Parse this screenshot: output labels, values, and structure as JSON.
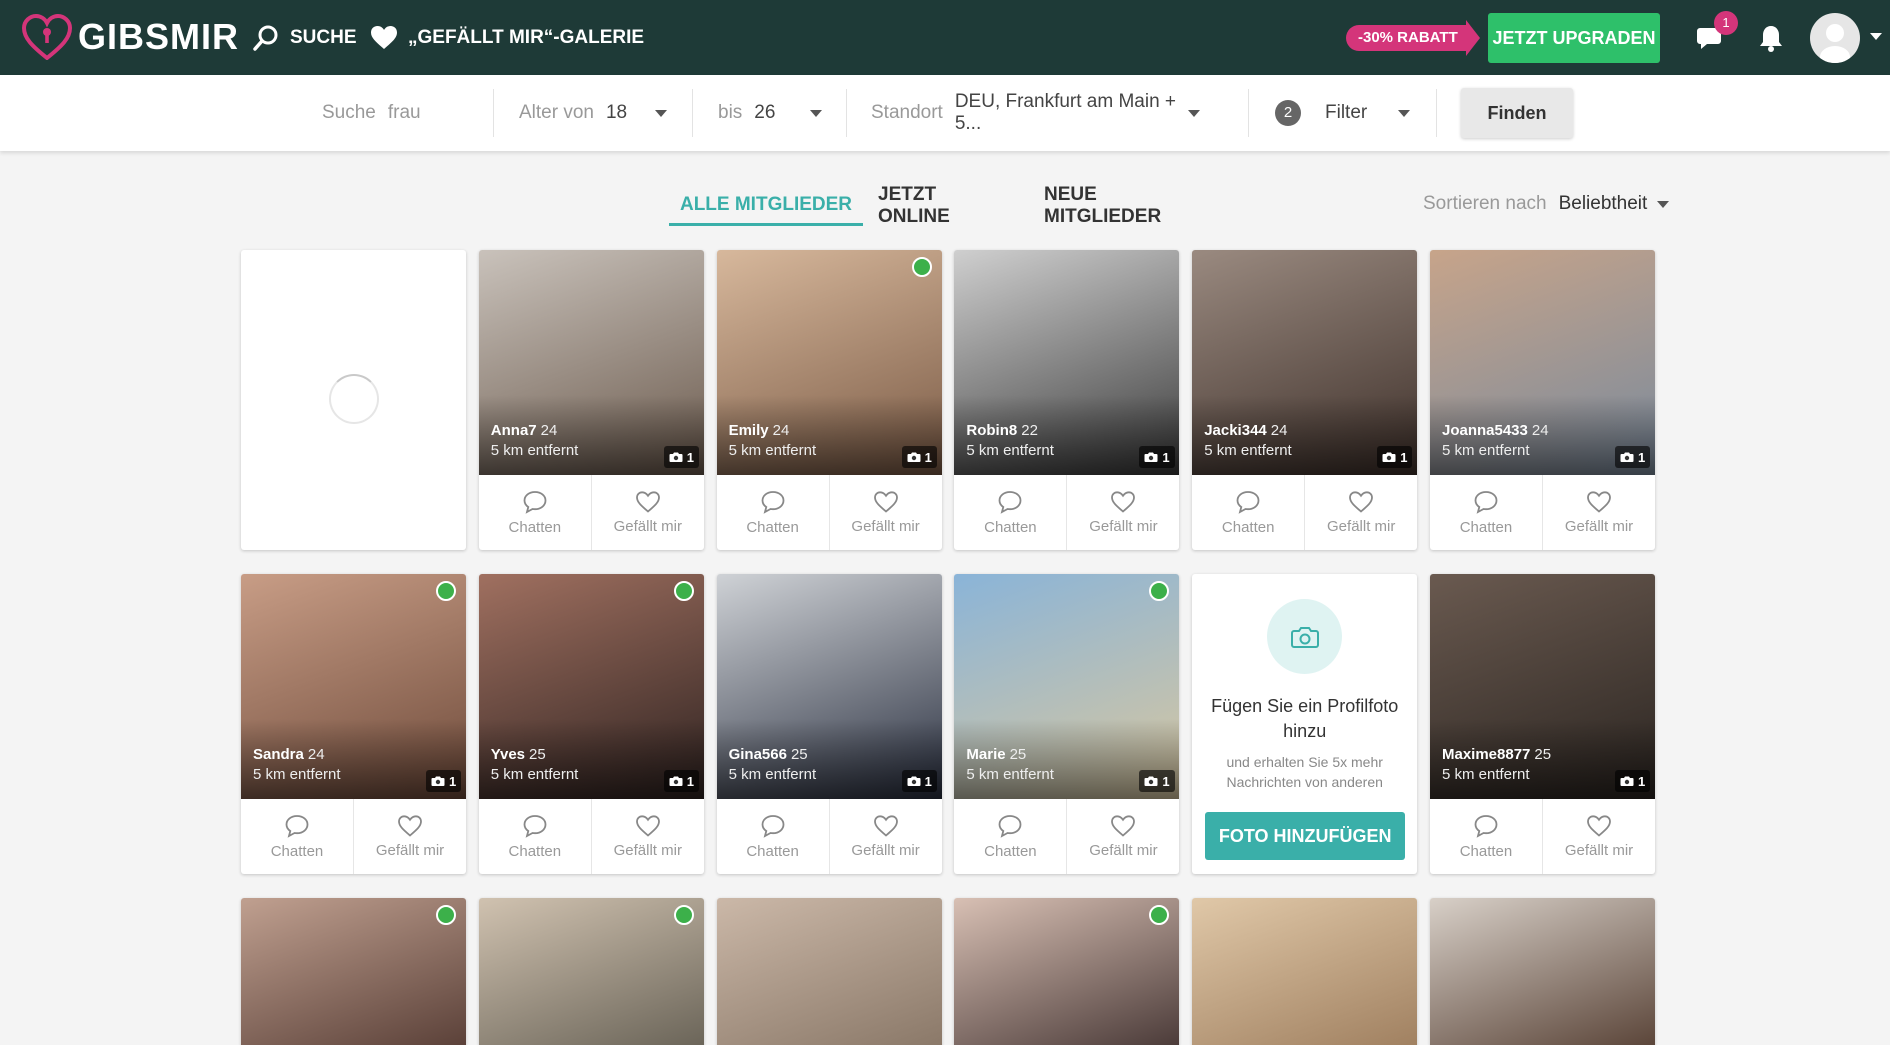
{
  "header": {
    "brand": "GIBSMIR",
    "nav_search": "Suche",
    "nav_gallery": "„Gefällt mir“-Galerie",
    "promo_badge": "-30% RABATT",
    "upgrade_label": "Jetzt upgraden",
    "messages_count": "1",
    "colors": {
      "bar": "#1e3a37",
      "accent": "#d4357a",
      "upgrade": "#2ec06a"
    }
  },
  "search": {
    "query_label": "Suche",
    "query_value": "frau",
    "age_from_label": "Alter von",
    "age_from_value": "18",
    "age_to_label": "bis",
    "age_to_value": "26",
    "location_label": "Standort",
    "location_value": "DEU, Frankfurt am Main + 5...",
    "filter_count": "2",
    "filter_label": "Filter",
    "find_label": "Finden"
  },
  "tabs": {
    "all": "Alle Mitglieder",
    "online": "Jetzt online",
    "new": "Neue Mitglieder",
    "active": "all",
    "accent_color": "#3aafa9"
  },
  "sort": {
    "label": "Sortieren nach",
    "value": "Beliebtheit"
  },
  "card_actions": {
    "chat": "Chatten",
    "like": "Gefällt mir"
  },
  "members_row1": [
    {
      "name": "Anna7",
      "age": "24",
      "distance": "5 km entfernt",
      "photos": "1",
      "online": false
    },
    {
      "name": "Emily",
      "age": "24",
      "distance": "5 km entfernt",
      "photos": "1",
      "online": true
    },
    {
      "name": "Robin8",
      "age": "22",
      "distance": "5 km entfernt",
      "photos": "1",
      "online": false
    },
    {
      "name": "Jacki344",
      "age": "24",
      "distance": "5 km entfernt",
      "photos": "1",
      "online": false
    },
    {
      "name": "Joanna5433",
      "age": "24",
      "distance": "5 km entfernt",
      "photos": "1",
      "online": false
    }
  ],
  "members_row2": [
    {
      "name": "Sandra",
      "age": "24",
      "distance": "5 km entfernt",
      "photos": "1",
      "online": true
    },
    {
      "name": "Yves",
      "age": "25",
      "distance": "5 km entfernt",
      "photos": "1",
      "online": true
    },
    {
      "name": "Gina566",
      "age": "25",
      "distance": "5 km entfernt",
      "photos": "1",
      "online": false
    },
    {
      "name": "Marie",
      "age": "25",
      "distance": "5 km entfernt",
      "photos": "1",
      "online": true
    },
    {
      "name": "Maxime8877",
      "age": "25",
      "distance": "5 km entfernt",
      "photos": "1",
      "online": false
    }
  ],
  "members_row3_online": [
    true,
    true,
    false,
    true,
    false,
    false
  ],
  "add_photo": {
    "title": "Fügen Sie ein Profilfoto hinzu",
    "subtitle": "und erhalten Sie 5x mehr Nachrichten von anderen",
    "button": "Foto hinzufügen"
  }
}
